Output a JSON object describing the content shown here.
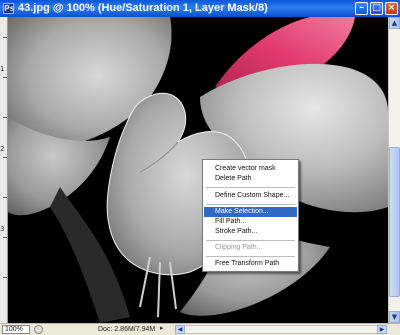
{
  "window": {
    "title": "43.jpg @ 100% (Hue/Saturation 1, Layer Mask/8)",
    "app_icon": "Ps",
    "controls": {
      "minimize": "–",
      "maximize": "□",
      "close": "×"
    }
  },
  "ruler": {
    "labels": [
      "1",
      "2",
      "3"
    ]
  },
  "statusbar": {
    "zoom": "100%",
    "doc_info": "Doc: 2.86M/7.94M",
    "arrow": "▸"
  },
  "scroll": {
    "up": "▲",
    "down": "▼",
    "left": "◀",
    "right": "▶"
  },
  "context_menu": {
    "items": [
      {
        "label": "Create vector mask",
        "state": "enabled"
      },
      {
        "label": "Delete Path",
        "state": "enabled"
      },
      {
        "label": "Define Custom Shape...",
        "state": "enabled"
      },
      {
        "label": "Make Selection...",
        "state": "selected"
      },
      {
        "label": "Fill Path...",
        "state": "enabled"
      },
      {
        "label": "Stroke Path...",
        "state": "enabled"
      },
      {
        "label": "Clipping Path...",
        "state": "disabled"
      },
      {
        "label": "Free Transform Path",
        "state": "enabled"
      }
    ]
  },
  "colors": {
    "titlebar": "#0a57d9",
    "selection": "#316ac5",
    "petal_pink": "#e23a6e",
    "canvas_bg": "#000000"
  }
}
